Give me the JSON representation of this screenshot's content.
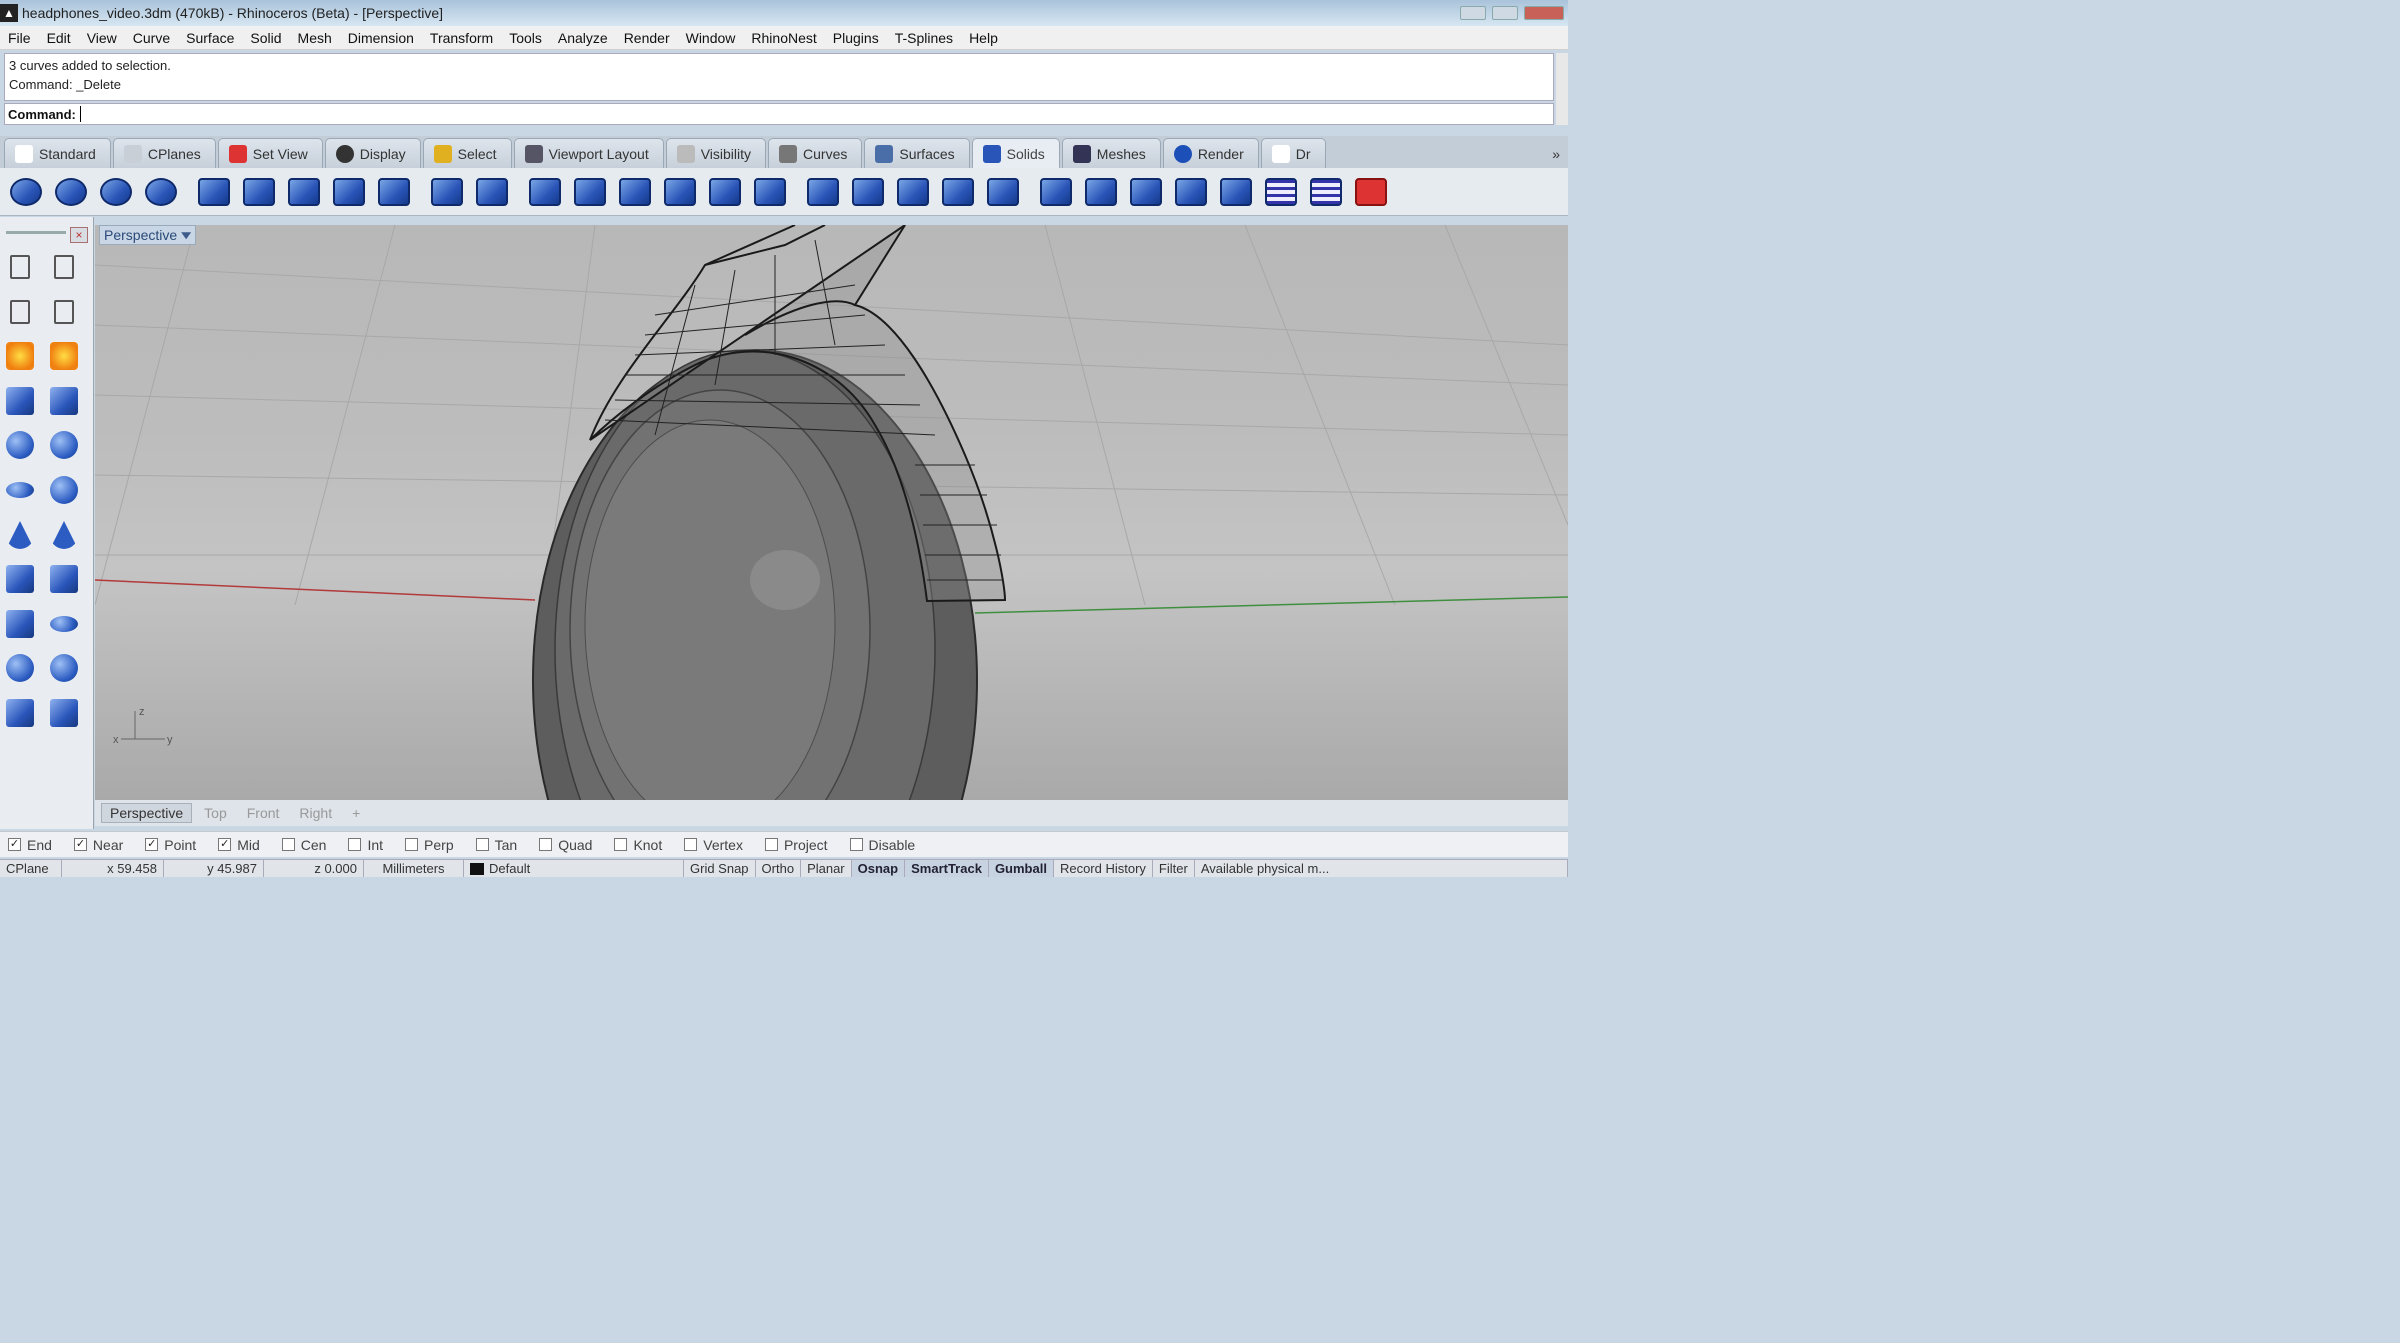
{
  "window": {
    "title": "headphones_video.3dm (470kB) - Rhinoceros (Beta) - [Perspective]"
  },
  "menu": [
    "File",
    "Edit",
    "View",
    "Curve",
    "Surface",
    "Solid",
    "Mesh",
    "Dimension",
    "Transform",
    "Tools",
    "Analyze",
    "Render",
    "Window",
    "RhinoNest",
    "Plugins",
    "T-Splines",
    "Help"
  ],
  "command": {
    "history": [
      "3 curves added to selection.",
      "Command: _Delete"
    ],
    "prompt": "Command:",
    "value": ""
  },
  "tabs": [
    {
      "label": "Standard",
      "icon": "document-icon"
    },
    {
      "label": "CPlanes",
      "icon": "cplanes-icon"
    },
    {
      "label": "Set View",
      "icon": "set-view-icon"
    },
    {
      "label": "Display",
      "icon": "display-icon"
    },
    {
      "label": "Select",
      "icon": "select-icon"
    },
    {
      "label": "Viewport Layout",
      "icon": "viewport-layout-icon"
    },
    {
      "label": "Visibility",
      "icon": "bulb-icon"
    },
    {
      "label": "Curves",
      "icon": "curves-icon"
    },
    {
      "label": "Surfaces",
      "icon": "surfaces-icon"
    },
    {
      "label": "Solids",
      "icon": "solids-icon",
      "active": true
    },
    {
      "label": "Meshes",
      "icon": "meshes-icon"
    },
    {
      "label": "Render",
      "icon": "render-sphere-icon"
    },
    {
      "label": "Dr",
      "icon": "drafting-icon"
    }
  ],
  "tab_overflow": "»",
  "viewport": {
    "name": "Perspective",
    "axes": {
      "x": "x",
      "y": "y",
      "z": "z"
    }
  },
  "viewport_tabs": [
    "Perspective",
    "Top",
    "Front",
    "Right",
    "+"
  ],
  "osnaps": [
    {
      "label": "End",
      "checked": true
    },
    {
      "label": "Near",
      "checked": true
    },
    {
      "label": "Point",
      "checked": true
    },
    {
      "label": "Mid",
      "checked": true
    },
    {
      "label": "Cen",
      "checked": false
    },
    {
      "label": "Int",
      "checked": false
    },
    {
      "label": "Perp",
      "checked": false
    },
    {
      "label": "Tan",
      "checked": false
    },
    {
      "label": "Quad",
      "checked": false
    },
    {
      "label": "Knot",
      "checked": false
    },
    {
      "label": "Vertex",
      "checked": false
    },
    {
      "label": "Project",
      "checked": false
    },
    {
      "label": "Disable",
      "checked": false
    }
  ],
  "status": {
    "cplane": "CPlane",
    "x": "x 59.458",
    "y": "y 45.987",
    "z": "z 0.000",
    "units": "Millimeters",
    "layer": "Default",
    "toggles": [
      "Grid Snap",
      "Ortho",
      "Planar",
      "Osnap",
      "SmartTrack",
      "Gumball",
      "Record History",
      "Filter"
    ],
    "active_toggles": [
      "Osnap",
      "SmartTrack",
      "Gumball"
    ],
    "memory": "Available physical m..."
  },
  "colors": {
    "x_axis": "#b23a3a",
    "y_axis": "#3f8f3f",
    "wire": "#1a1a1a"
  }
}
